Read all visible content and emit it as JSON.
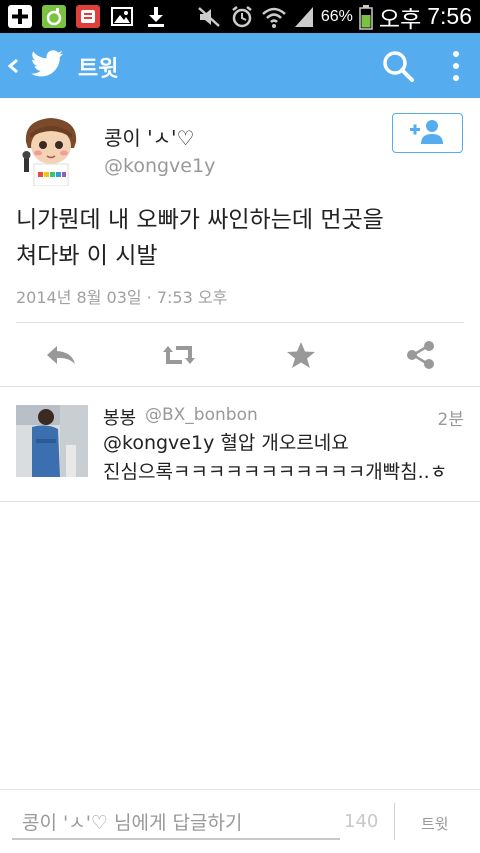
{
  "status_bar": {
    "battery_percent": "66%",
    "ampm": "오후",
    "time": "7:56",
    "icons": [
      "add-icon",
      "app-green-icon",
      "app-red-icon",
      "image-icon",
      "download-icon",
      "mute-icon",
      "alarm-icon",
      "wifi-icon",
      "signal-icon",
      "battery-icon"
    ]
  },
  "app_bar": {
    "title": "트윗",
    "accent_color": "#55acee"
  },
  "tweet": {
    "author_name": "콩이 'ㅅ'♡",
    "author_handle": "@kongve1y",
    "text_lines": [
      "니가뭔데 내 오빠가 싸인하는데 먼곳을",
      "쳐다봐 이 시발"
    ],
    "meta": "2014년 8월 03일 · 7:53 오후"
  },
  "actions": [
    "reply-icon",
    "retweet-icon",
    "favorite-icon",
    "share-icon"
  ],
  "reply": {
    "author_name": "봉봉",
    "author_handle": "@BX_bonbon",
    "time": "2분",
    "text_lines": [
      "@kongve1y 혈압 개오르네요",
      "진심으록ㅋㅋㅋㅋㅋㅋㅋㅋㅋㅋㅋ개빡침..ㅎ"
    ]
  },
  "composer": {
    "placeholder": "콩이 'ㅅ'♡ 님에게 답글하기",
    "char_count": "140",
    "send_label": "트윗"
  }
}
